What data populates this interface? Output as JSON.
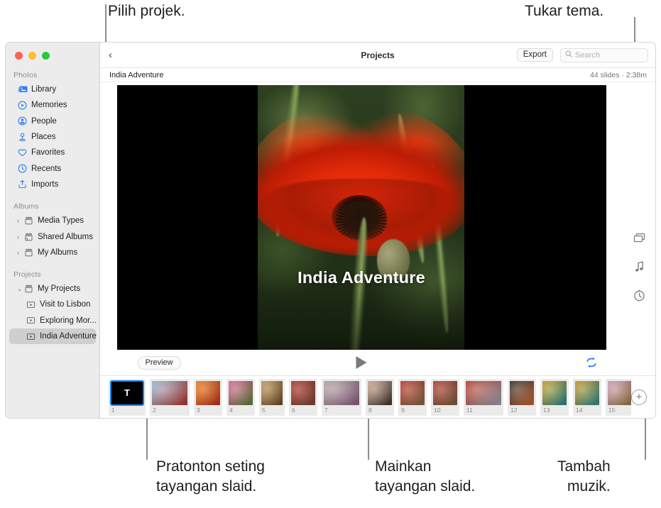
{
  "callouts": [
    {
      "id": "select-project",
      "text": "Pilih projek."
    },
    {
      "id": "change-theme",
      "text": "Tukar tema."
    },
    {
      "id": "preview-settings",
      "text": "Pratonton seting\ntayangan slaid."
    },
    {
      "id": "play-slideshow",
      "text": "Mainkan\ntayangan slaid."
    },
    {
      "id": "add-music",
      "text": "Tambah\nmuzik."
    }
  ],
  "window": {
    "traffic_lights": [
      "close",
      "minimize",
      "zoom"
    ]
  },
  "sidebar": {
    "sections": [
      {
        "title": "Photos",
        "items": [
          {
            "label": "Library",
            "icon": "photos-library-icon",
            "disclosure": "",
            "nested": false,
            "selected": false
          },
          {
            "label": "Memories",
            "icon": "memories-icon",
            "disclosure": "",
            "nested": false,
            "selected": false
          },
          {
            "label": "People",
            "icon": "people-icon",
            "disclosure": "",
            "nested": false,
            "selected": false
          },
          {
            "label": "Places",
            "icon": "places-pin-icon",
            "disclosure": "",
            "nested": false,
            "selected": false
          },
          {
            "label": "Favorites",
            "icon": "heart-icon",
            "disclosure": "",
            "nested": false,
            "selected": false
          },
          {
            "label": "Recents",
            "icon": "clock-icon",
            "disclosure": "",
            "nested": false,
            "selected": false
          },
          {
            "label": "Imports",
            "icon": "import-icon",
            "disclosure": "",
            "nested": false,
            "selected": false
          }
        ]
      },
      {
        "title": "Albums",
        "items": [
          {
            "label": "Media Types",
            "icon": "album-folder-icon",
            "disclosure": "›",
            "nested": false,
            "selected": false
          },
          {
            "label": "Shared Albums",
            "icon": "shared-album-icon",
            "disclosure": "›",
            "nested": false,
            "selected": false
          },
          {
            "label": "My Albums",
            "icon": "album-folder-icon",
            "disclosure": "›",
            "nested": false,
            "selected": false
          }
        ]
      },
      {
        "title": "Projects",
        "items": [
          {
            "label": "My Projects",
            "icon": "album-folder-icon",
            "disclosure": "⌄",
            "nested": false,
            "selected": false
          },
          {
            "label": "Visit to Lisbon",
            "icon": "slideshow-icon",
            "disclosure": "",
            "nested": true,
            "selected": false
          },
          {
            "label": "Exploring Mor...",
            "icon": "slideshow-icon",
            "disclosure": "",
            "nested": true,
            "selected": false
          },
          {
            "label": "India Adventure",
            "icon": "slideshow-icon",
            "disclosure": "",
            "nested": true,
            "selected": true
          }
        ]
      }
    ]
  },
  "toolbar": {
    "back_label": "‹",
    "title": "Projects",
    "export_label": "Export",
    "search_placeholder": "Search",
    "search_value": "",
    "search_icon": "search-icon"
  },
  "subbar": {
    "project_name": "India Adventure",
    "meta": "44 slides · 2:38m"
  },
  "stage": {
    "slide_title": "India Adventure",
    "preview_label": "Preview",
    "play_icon": "play-triangle-icon",
    "loop_icon": "repeat-loop-icon",
    "loop_color": "#1a7ef0"
  },
  "rail": {
    "items": [
      {
        "name": "theme-icon",
        "tooltip": "Themes"
      },
      {
        "name": "music-note-icon",
        "tooltip": "Music"
      },
      {
        "name": "duration-timer-icon",
        "tooltip": "Duration"
      }
    ]
  },
  "filmstrip": {
    "add_label": "+",
    "slides": [
      {
        "number": "1",
        "kind": "title",
        "letter": "T",
        "selected": true,
        "c1": "#000000",
        "c2": "#000000"
      },
      {
        "number": "2",
        "kind": "photo",
        "selected": false,
        "c1": "#9fc4e0",
        "c2": "#b5352b"
      },
      {
        "number": "3",
        "kind": "photo",
        "selected": false,
        "c1": "#f2871f",
        "c2": "#c0301a"
      },
      {
        "number": "4",
        "kind": "photo",
        "selected": false,
        "c1": "#e8669b",
        "c2": "#5c7f3a"
      },
      {
        "number": "5",
        "kind": "photo",
        "selected": false,
        "c1": "#c9a05c",
        "c2": "#6d4a28"
      },
      {
        "number": "6",
        "kind": "photo",
        "selected": false,
        "c1": "#b9332a",
        "c2": "#7a4a38"
      },
      {
        "number": "7",
        "kind": "photo",
        "selected": false,
        "c1": "#bdb3ab",
        "c2": "#8d5f86"
      },
      {
        "number": "8",
        "kind": "photo",
        "selected": false,
        "c1": "#d9b39b",
        "c2": "#3a2f2a"
      },
      {
        "number": "9",
        "kind": "photo",
        "selected": false,
        "c1": "#c0392b",
        "c2": "#8a6a4a"
      },
      {
        "number": "10",
        "kind": "photo",
        "selected": false,
        "c1": "#b83a2c",
        "c2": "#7d5f45"
      },
      {
        "number": "11",
        "kind": "photo",
        "selected": false,
        "c1": "#c23a26",
        "c2": "#9aa7b2"
      },
      {
        "number": "12",
        "kind": "photo",
        "selected": false,
        "c1": "#2b2b2b",
        "c2": "#d06a33"
      },
      {
        "number": "13",
        "kind": "photo",
        "selected": false,
        "c1": "#d8a41f",
        "c2": "#1f8a8f"
      },
      {
        "number": "14",
        "kind": "photo",
        "selected": false,
        "c1": "#d49a22",
        "c2": "#2a8e92"
      },
      {
        "number": "15",
        "kind": "photo",
        "selected": false,
        "c1": "#d6a7c4",
        "c2": "#9b7a3e"
      }
    ]
  }
}
